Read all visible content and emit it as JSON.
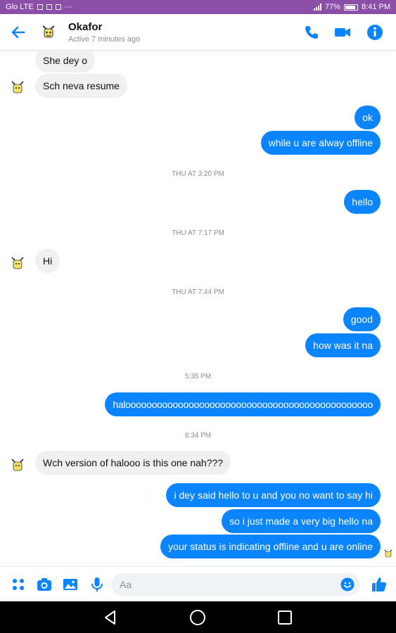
{
  "status_bar": {
    "carrier": "Glo LTE",
    "battery": "77%",
    "time": "8:41 PM"
  },
  "header": {
    "contact_name": "Okafor",
    "active_status": "Active 7 minutes ago"
  },
  "accent_color": "#0084ff",
  "messages": {
    "m1": "She dey o",
    "m2": "Sch neva resume",
    "m3": "ok",
    "m4": "while u are alway offline",
    "t1": "THU AT 3:20 PM",
    "m5": "hello",
    "t2": "THU AT 7:17 PM",
    "m6": "Hi",
    "t3": "THU AT 7:44 PM",
    "m7": "good",
    "m8": "how was it na",
    "t4": "5:35 PM",
    "m9": "halooooooooooooooooooooooooooooooooooooooooooooooo",
    "t5": "8:34 PM",
    "m10": "Wch version of halooo is this one nah???",
    "m11": "i dey said hello to u and you no want to say hi",
    "m12": "so i just made a very big hello na",
    "m13": "your status is indicating offline and u are online"
  },
  "composer": {
    "placeholder": "Aa"
  }
}
